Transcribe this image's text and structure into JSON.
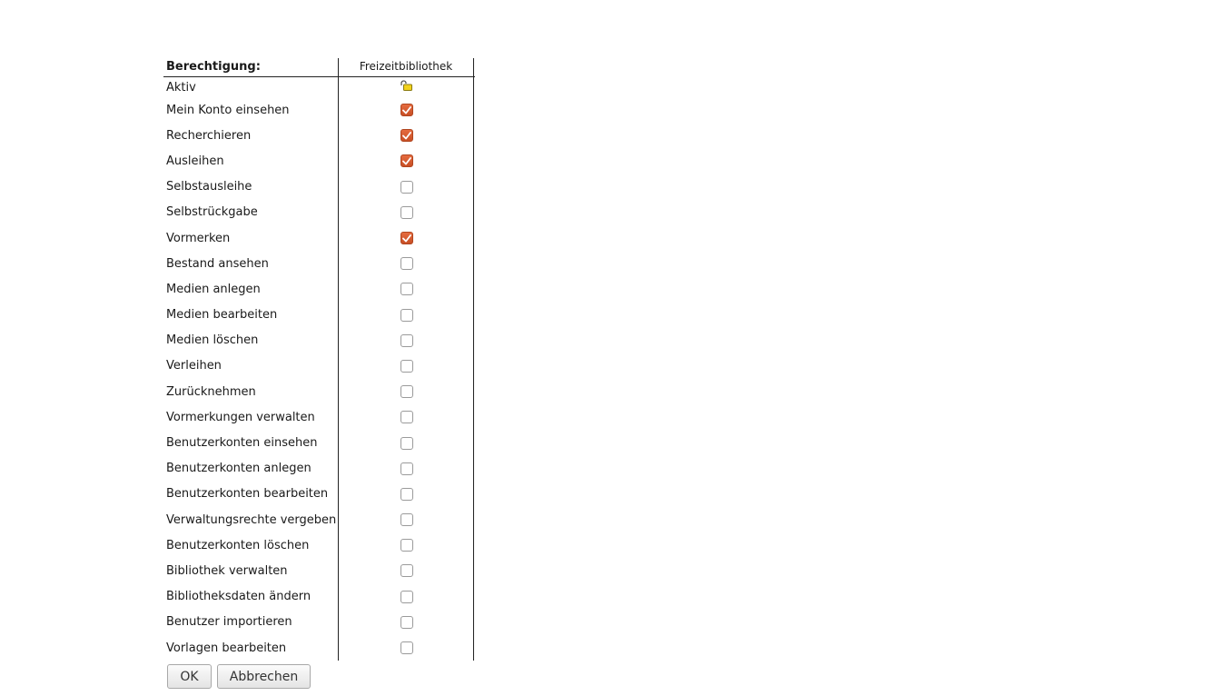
{
  "table": {
    "header_label": "Berechtigung:",
    "column_library": "Freizeitbibliothek",
    "active_row": {
      "label": "Aktiv",
      "icon": "open-lock-icon"
    },
    "permissions": [
      {
        "label": "Mein Konto einsehen",
        "checked": true
      },
      {
        "label": "Recherchieren",
        "checked": true
      },
      {
        "label": "Ausleihen",
        "checked": true
      },
      {
        "label": "Selbstausleihe",
        "checked": false
      },
      {
        "label": "Selbstrückgabe",
        "checked": false
      },
      {
        "label": "Vormerken",
        "checked": true
      },
      {
        "label": "Bestand ansehen",
        "checked": false
      },
      {
        "label": "Medien anlegen",
        "checked": false
      },
      {
        "label": "Medien bearbeiten",
        "checked": false
      },
      {
        "label": "Medien löschen",
        "checked": false
      },
      {
        "label": "Verleihen",
        "checked": false
      },
      {
        "label": "Zurücknehmen",
        "checked": false
      },
      {
        "label": "Vormerkungen verwalten",
        "checked": false
      },
      {
        "label": "Benutzerkonten einsehen",
        "checked": false
      },
      {
        "label": "Benutzerkonten anlegen",
        "checked": false
      },
      {
        "label": "Benutzerkonten bearbeiten",
        "checked": false
      },
      {
        "label": "Verwaltungsrechte vergeben",
        "checked": false
      },
      {
        "label": "Benutzerkonten löschen",
        "checked": false
      },
      {
        "label": "Bibliothek verwalten",
        "checked": false
      },
      {
        "label": "Bibliotheksdaten ändern",
        "checked": false
      },
      {
        "label": "Benutzer importieren",
        "checked": false
      },
      {
        "label": "Vorlagen bearbeiten",
        "checked": false
      }
    ]
  },
  "buttons": {
    "ok_label": "OK",
    "cancel_label": "Abbrechen"
  },
  "colors": {
    "checkbox_checked": "#d9592c",
    "lock_icon": "#f2d21b"
  }
}
